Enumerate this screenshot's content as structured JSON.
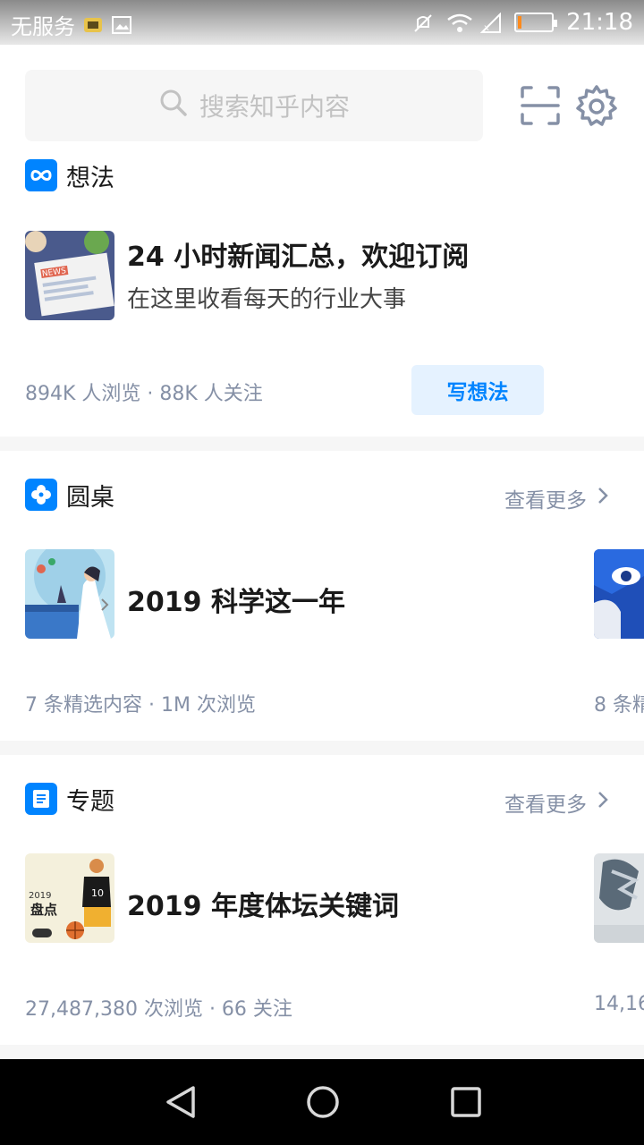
{
  "status_bar": {
    "carrier": "无服务",
    "time": "21:18",
    "battery_level": 0.12,
    "icons": [
      "sim-icon",
      "image-icon",
      "mute-icon",
      "wifi-icon",
      "no-signal-icon",
      "battery-icon"
    ]
  },
  "search": {
    "placeholder": "搜索知乎内容"
  },
  "top_icons": [
    "scan-icon",
    "settings-icon"
  ],
  "sections": {
    "ideas": {
      "title": "想法",
      "card": {
        "title": "24 小时新闻汇总，欢迎订阅",
        "subtitle": "在这里收看每天的行业大事",
        "meta": "894K 人浏览 · 88K 人关注",
        "button": "写想法",
        "thumb_label": "NEWS"
      }
    },
    "roundtable": {
      "title": "圆桌",
      "more": "查看更多",
      "card": {
        "title": "2019 科学这一年",
        "meta": "7 条精选内容 · 1M 次浏览"
      },
      "peek_meta": "8 条精"
    },
    "topics": {
      "title": "专题",
      "more": "查看更多",
      "card": {
        "title": "2019 年度体坛关键词",
        "meta": "27,487,380 次浏览 · 66 关注",
        "thumb_label": "盘点",
        "thumb_year": "2019"
      },
      "peek_meta": "14,16"
    }
  },
  "nav": [
    "back-icon",
    "home-icon",
    "recents-icon"
  ],
  "colors": {
    "accent": "#0084ff",
    "meta": "#8590a6",
    "button_bg": "#e5f2ff"
  }
}
